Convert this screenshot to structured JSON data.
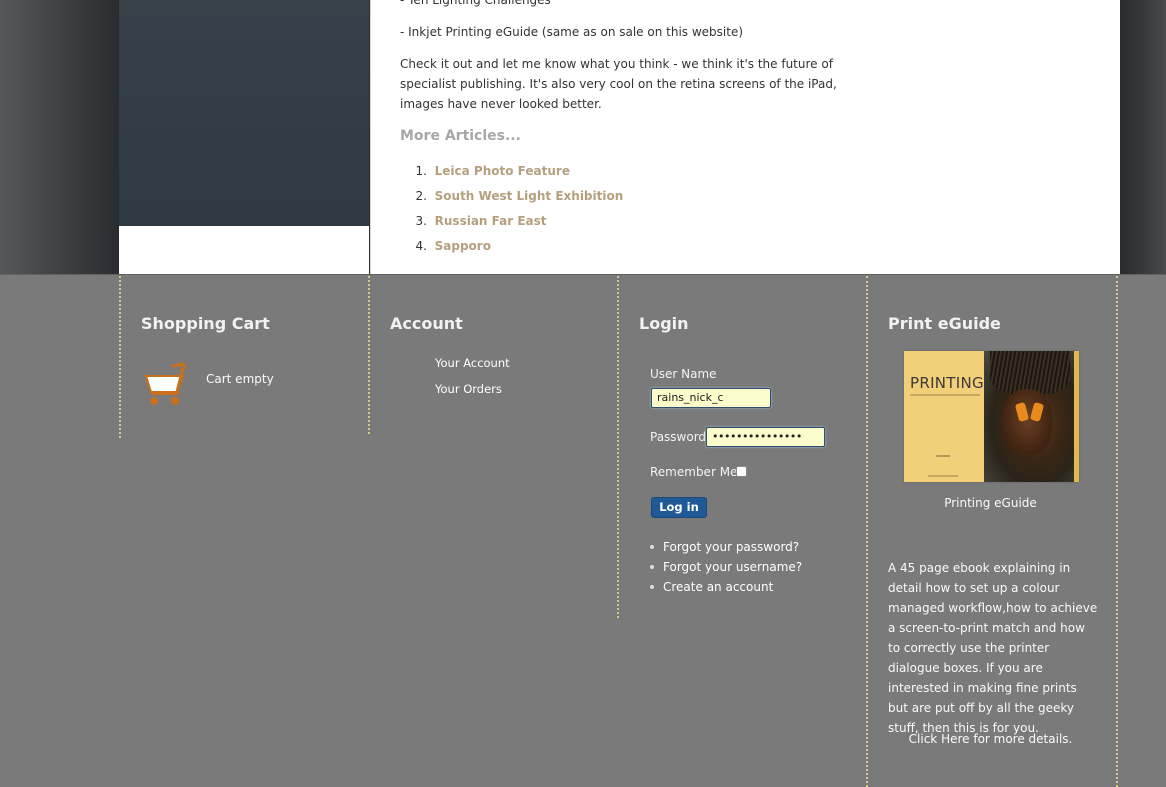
{
  "article": {
    "line_top": "- Ten Lighting Challenges",
    "line_inkjet": "- Inkjet Printing eGuide (same as on sale on this website)",
    "paragraph": "Check it out and let me know what you think - we think it's the future of specialist publishing. It's also very cool on the retina screens of the iPad, images have never looked better.",
    "more_heading": "More Articles...",
    "more_articles": [
      {
        "num": "1.",
        "label": "Leica Photo Feature"
      },
      {
        "num": "2.",
        "label": "South West Light Exhibition"
      },
      {
        "num": "3.",
        "label": "Russian Far East"
      },
      {
        "num": "4.",
        "label": "Sapporo"
      }
    ]
  },
  "cart": {
    "title": "Shopping Cart",
    "status": "Cart empty",
    "icon": "shopping-cart-icon"
  },
  "account": {
    "title": "Account",
    "links": [
      "Your Account",
      "Your Orders"
    ]
  },
  "login": {
    "title": "Login",
    "username_label": "User Name",
    "username_value": "rains_nick_c",
    "password_label": "Password",
    "password_value": "•••••••••••••••",
    "remember_label": "Remember Me",
    "remember_checked": false,
    "button_label": "Log in",
    "links": [
      "Forgot your password?",
      "Forgot your username?",
      "Create an account"
    ]
  },
  "eguide": {
    "title": "Print eGuide",
    "cover_title": "PRINTING",
    "caption": "Printing eGuide",
    "description": "A 45 page ebook explaining in detail how to set up a colour managed workflow,how to achieve a screen-to-print match and how to correctly use the printer dialogue boxes. If you are interested in making fine prints but are put off by all the geeky stuff, then this is for you.",
    "details_link": "Click Here for more details."
  },
  "colors": {
    "link_tan": "#b59f7f",
    "footer_bg": "#7a7a7a",
    "divider_dots": "#d8c98c",
    "button_blue": "#1f5a96"
  }
}
